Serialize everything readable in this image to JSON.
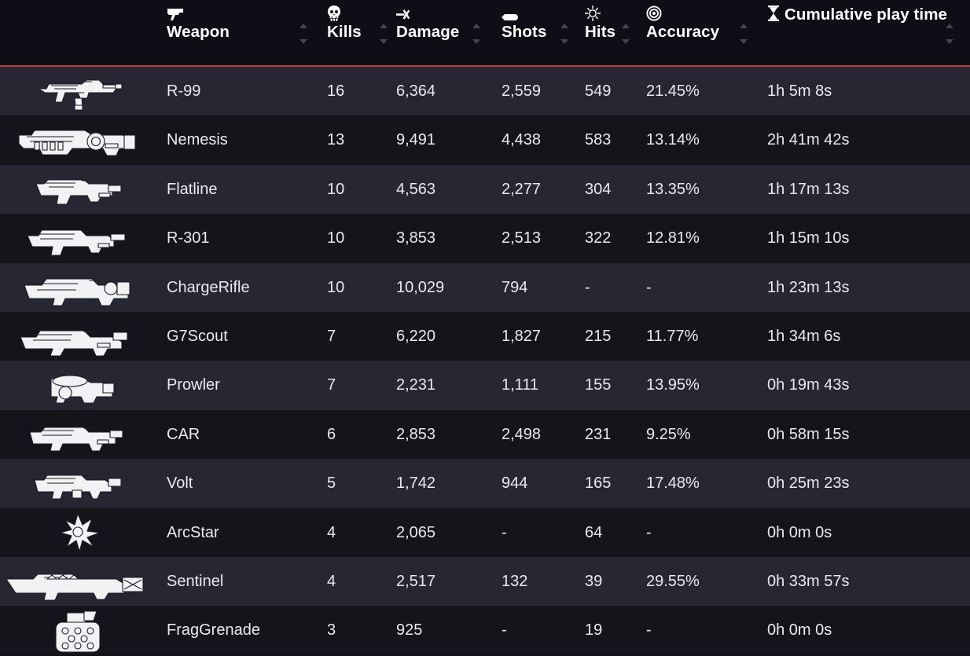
{
  "table": {
    "columns": [
      {
        "key": "icon",
        "label": "",
        "icon": "none",
        "sortable": false
      },
      {
        "key": "weapon",
        "label": "Weapon",
        "icon": "pistol-icon",
        "sortable": true
      },
      {
        "key": "kills",
        "label": "Kills",
        "icon": "skull-icon",
        "sortable": true
      },
      {
        "key": "damage",
        "label": "Damage",
        "icon": "damage-icon",
        "sortable": true
      },
      {
        "key": "shots",
        "label": "Shots",
        "icon": "bullet-icon",
        "sortable": true
      },
      {
        "key": "hits",
        "label": "Hits",
        "icon": "crosshair-icon",
        "sortable": true
      },
      {
        "key": "accuracy",
        "label": "Accuracy",
        "icon": "target-icon",
        "sortable": true
      },
      {
        "key": "time",
        "label": "Cumulative play time",
        "icon": "hourglass-icon",
        "sortable": true
      }
    ],
    "rows": [
      {
        "icon": "r99-icon",
        "weapon": "R-99",
        "kills": "16",
        "damage": "6,364",
        "shots": "2,559",
        "hits": "549",
        "accuracy": "21.45%",
        "time": "1h 5m 8s"
      },
      {
        "icon": "nemesis-icon",
        "weapon": "Nemesis",
        "kills": "13",
        "damage": "9,491",
        "shots": "4,438",
        "hits": "583",
        "accuracy": "13.14%",
        "time": "2h 41m 42s"
      },
      {
        "icon": "flatline-icon",
        "weapon": "Flatline",
        "kills": "10",
        "damage": "4,563",
        "shots": "2,277",
        "hits": "304",
        "accuracy": "13.35%",
        "time": "1h 17m 13s"
      },
      {
        "icon": "r301-icon",
        "weapon": "R-301",
        "kills": "10",
        "damage": "3,853",
        "shots": "2,513",
        "hits": "322",
        "accuracy": "12.81%",
        "time": "1h 15m 10s"
      },
      {
        "icon": "chargerifle-icon",
        "weapon": "ChargeRifle",
        "kills": "10",
        "damage": "10,029",
        "shots": "794",
        "hits": "-",
        "accuracy": "-",
        "time": "1h 23m 13s"
      },
      {
        "icon": "g7scout-icon",
        "weapon": "G7Scout",
        "kills": "7",
        "damage": "6,220",
        "shots": "1,827",
        "hits": "215",
        "accuracy": "11.77%",
        "time": "1h 34m 6s"
      },
      {
        "icon": "prowler-icon",
        "weapon": "Prowler",
        "kills": "7",
        "damage": "2,231",
        "shots": "1,111",
        "hits": "155",
        "accuracy": "13.95%",
        "time": "0h 19m 43s"
      },
      {
        "icon": "car-icon",
        "weapon": "CAR",
        "kills": "6",
        "damage": "2,853",
        "shots": "2,498",
        "hits": "231",
        "accuracy": "9.25%",
        "time": "0h 58m 15s"
      },
      {
        "icon": "volt-icon",
        "weapon": "Volt",
        "kills": "5",
        "damage": "1,742",
        "shots": "944",
        "hits": "165",
        "accuracy": "17.48%",
        "time": "0h 25m 23s"
      },
      {
        "icon": "arcstar-icon",
        "weapon": "ArcStar",
        "kills": "4",
        "damage": "2,065",
        "shots": "-",
        "hits": "64",
        "accuracy": "-",
        "time": "0h 0m 0s"
      },
      {
        "icon": "sentinel-icon",
        "weapon": "Sentinel",
        "kills": "4",
        "damage": "2,517",
        "shots": "132",
        "hits": "39",
        "accuracy": "29.55%",
        "time": "0h 33m 57s"
      },
      {
        "icon": "fraggrenade-icon",
        "weapon": "FragGrenade",
        "kills": "3",
        "damage": "925",
        "shots": "-",
        "hits": "19",
        "accuracy": "-",
        "time": "0h 0m 0s"
      }
    ]
  },
  "colors": {
    "header_bg": "#0e0e16",
    "header_rule": "#c0392b",
    "row_odd": "#272733",
    "row_even": "#14141b",
    "text": "#e9e9ee",
    "header_text": "#ffffff",
    "sort_arrow": "#45454f"
  }
}
